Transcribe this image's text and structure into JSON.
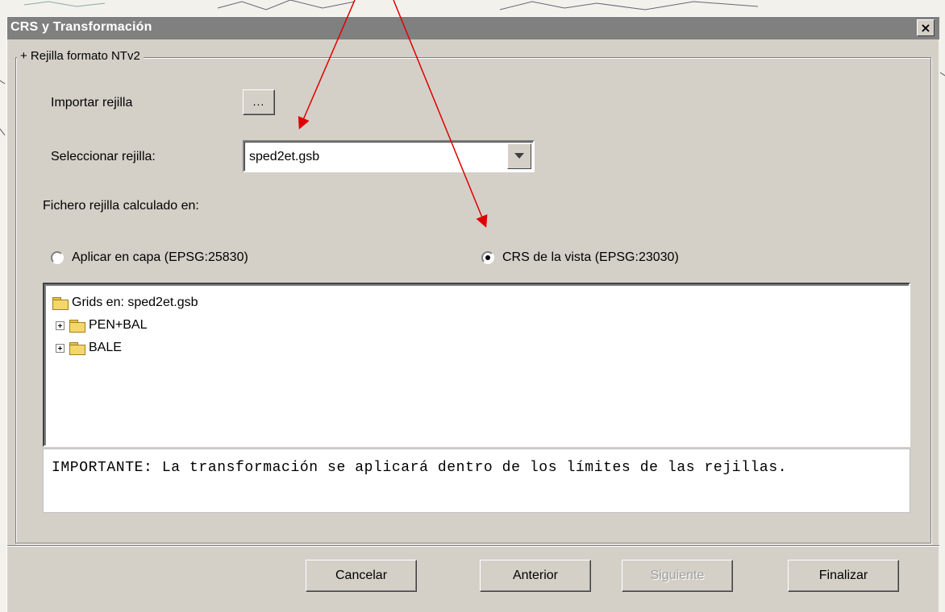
{
  "dialog": {
    "title": "CRS y Transformación",
    "close_glyph": "×"
  },
  "group": {
    "legend": "+ Rejilla formato NTv2"
  },
  "import": {
    "label": "Importar rejilla",
    "button": "..."
  },
  "select": {
    "label": "Seleccionar rejilla:",
    "value": "sped2et.gsb"
  },
  "computed": {
    "label": "Fichero rejilla calculado en:"
  },
  "radios": [
    {
      "label": "Aplicar en capa (EPSG:25830)",
      "selected": false
    },
    {
      "label": "CRS de la vista (EPSG:23030)",
      "selected": true
    }
  ],
  "tree": {
    "root": "Grids en: sped2et.gsb",
    "children": [
      "PEN+BAL",
      "BALE"
    ]
  },
  "note": {
    "text": "IMPORTANTE: La transformación se aplicará dentro de los límites de las rejillas."
  },
  "buttons": {
    "cancel": "Cancelar",
    "previous": "Anterior",
    "next": "Siguiente",
    "finish": "Finalizar"
  },
  "colors": {
    "annotation_arrow": "#e00000",
    "titlebar_inactive": "#808080"
  }
}
